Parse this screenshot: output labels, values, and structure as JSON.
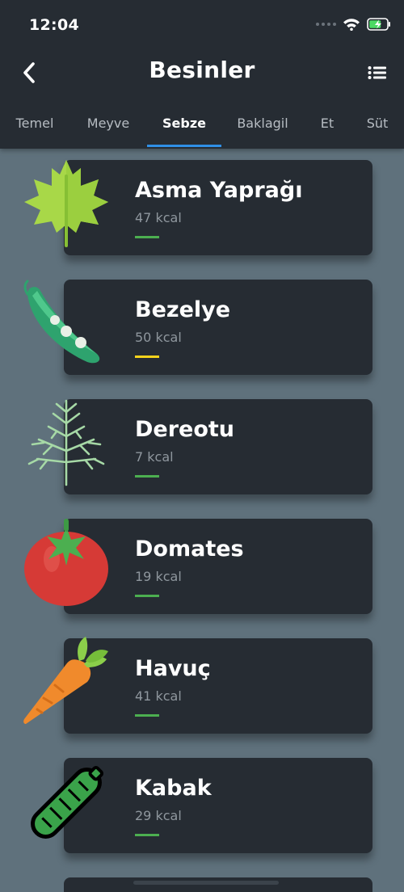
{
  "status": {
    "time": "12:04"
  },
  "header": {
    "title": "Besinler"
  },
  "tabs": [
    {
      "label": "Temel"
    },
    {
      "label": "Meyve"
    },
    {
      "label": "Sebze"
    },
    {
      "label": "Baklagil"
    },
    {
      "label": "Et"
    },
    {
      "label": "Süt"
    }
  ],
  "active_tab": "Sebze",
  "items": [
    {
      "name": "Asma Yaprağı",
      "kcal": "47 kcal",
      "bar_color": "#4caf50",
      "icon": "vine-leaf-icon"
    },
    {
      "name": "Bezelye",
      "kcal": "50 kcal",
      "bar_color": "#f5d31c",
      "icon": "pea-pod-icon"
    },
    {
      "name": "Dereotu",
      "kcal": "7 kcal",
      "bar_color": "#4caf50",
      "icon": "dill-icon"
    },
    {
      "name": "Domates",
      "kcal": "19 kcal",
      "bar_color": "#4caf50",
      "icon": "tomato-icon"
    },
    {
      "name": "Havuç",
      "kcal": "41 kcal",
      "bar_color": "#4caf50",
      "icon": "carrot-icon"
    },
    {
      "name": "Kabak",
      "kcal": "29 kcal",
      "bar_color": "#4caf50",
      "icon": "zucchini-icon"
    }
  ],
  "colors": {
    "accent": "#2f8fe6",
    "card": "#262c33",
    "background": "#5f717c"
  }
}
